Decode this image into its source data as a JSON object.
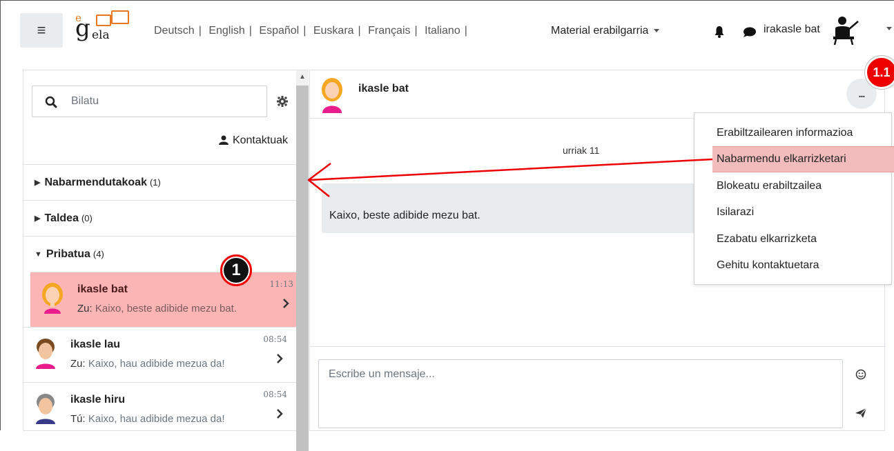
{
  "navbar": {
    "menu_icon": "hamburger-icon",
    "logo_text_e": "e",
    "logo_text_g": "g",
    "logo_text_ela": "ela",
    "languages": [
      "Deutsch",
      "English",
      "Español",
      "Euskara",
      "Français",
      "Italiano"
    ],
    "material_label": "Material erabilgarria",
    "username": "irakasle bat"
  },
  "sidebar": {
    "search_placeholder": "Bilatu",
    "contacts_label": "Kontaktuak",
    "sections": [
      {
        "label": "Nabarmendutakoak",
        "count": "(1)"
      },
      {
        "label": "Taldea",
        "count": "(0)"
      },
      {
        "label": "Pribatua",
        "count": "(4)"
      }
    ],
    "conversations": [
      {
        "name": "ikasle bat",
        "time": "11:13",
        "sender": "Zu:",
        "preview": "Kaixo, beste adibide mezu bat."
      },
      {
        "name": "ikasle lau",
        "time": "08:54",
        "sender": "Zu:",
        "preview": "Kaixo, hau adibide mezua da!"
      },
      {
        "name": "ikasle hiru",
        "time": "08:54",
        "sender": "Tú:",
        "preview": "Kaixo, hau adibide mezua da!"
      }
    ],
    "step_badge": "1"
  },
  "chat": {
    "contact_name": "ikasle bat",
    "date": "urriak 11",
    "message": "Kaixo, beste adibide mezu bat.",
    "composer_placeholder": "Escribe un mensaje...",
    "options_label": "...",
    "step_badge": "1.1"
  },
  "menu": {
    "items": [
      "Erabiltzailearen informazioa",
      "Nabarmendu elkarrizketari",
      "Blokeatu erabiltzailea",
      "Isilarazi",
      "Ezabatu elkarrizketa",
      "Gehitu kontaktuetara"
    ]
  },
  "colors": {
    "highlight": "#fcb5b5",
    "annotation_red": "#e00000",
    "logo_orange": "#e87722"
  }
}
